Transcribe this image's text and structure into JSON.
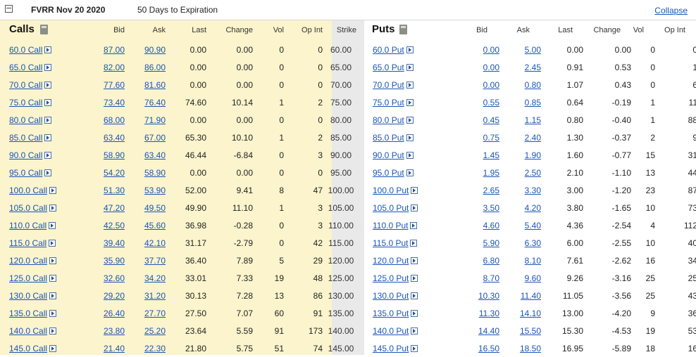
{
  "title": {
    "symbol": "FVRR Nov 20 2020",
    "expiration": "50 Days to Expiration",
    "collapse_label": "Collapse",
    "collapse_box": "−"
  },
  "headers": {
    "calls": "Calls",
    "puts": "Puts",
    "bid": "Bid",
    "ask": "Ask",
    "last": "Last",
    "change": "Change",
    "vol": "Vol",
    "op_int": "Op Int",
    "strike": "Strike"
  },
  "rows": [
    {
      "call": "60.0 Call",
      "c_bid": "87.00",
      "c_ask": "90.90",
      "c_last": "0.00",
      "c_chg": "0.00",
      "c_vol": "0",
      "c_oi": "0",
      "strike": "60.00",
      "put": "60.0 Put",
      "p_bid": "0.00",
      "p_ask": "5.00",
      "p_last": "0.00",
      "p_chg": "0.00",
      "p_vol": "0",
      "p_oi": "0"
    },
    {
      "call": "65.0 Call",
      "c_bid": "82.00",
      "c_ask": "86.00",
      "c_last": "0.00",
      "c_chg": "0.00",
      "c_vol": "0",
      "c_oi": "0",
      "strike": "65.00",
      "put": "65.0 Put",
      "p_bid": "0.00",
      "p_ask": "2.45",
      "p_last": "0.91",
      "p_chg": "0.53",
      "p_vol": "0",
      "p_oi": "1"
    },
    {
      "call": "70.0 Call",
      "c_bid": "77.60",
      "c_ask": "81.60",
      "c_last": "0.00",
      "c_chg": "0.00",
      "c_vol": "0",
      "c_oi": "0",
      "strike": "70.00",
      "put": "70.0 Put",
      "p_bid": "0.00",
      "p_ask": "0.80",
      "p_last": "1.07",
      "p_chg": "0.43",
      "p_vol": "0",
      "p_oi": "6"
    },
    {
      "call": "75.0 Call",
      "c_bid": "73.40",
      "c_ask": "76.40",
      "c_last": "74.60",
      "c_chg": "10.14",
      "c_vol": "1",
      "c_oi": "2",
      "strike": "75.00",
      "put": "75.0 Put",
      "p_bid": "0.55",
      "p_ask": "0.85",
      "p_last": "0.64",
      "p_chg": "-0.19",
      "p_vol": "1",
      "p_oi": "11"
    },
    {
      "call": "80.0 Call",
      "c_bid": "68.00",
      "c_ask": "71.90",
      "c_last": "0.00",
      "c_chg": "0.00",
      "c_vol": "0",
      "c_oi": "0",
      "strike": "80.00",
      "put": "80.0 Put",
      "p_bid": "0.45",
      "p_ask": "1.15",
      "p_last": "0.80",
      "p_chg": "-0.40",
      "p_vol": "1",
      "p_oi": "88"
    },
    {
      "call": "85.0 Call",
      "c_bid": "63.40",
      "c_ask": "67.00",
      "c_last": "65.30",
      "c_chg": "10.10",
      "c_vol": "1",
      "c_oi": "2",
      "strike": "85.00",
      "put": "85.0 Put",
      "p_bid": "0.75",
      "p_ask": "2.40",
      "p_last": "1.30",
      "p_chg": "-0.37",
      "p_vol": "2",
      "p_oi": "9"
    },
    {
      "call": "90.0 Call",
      "c_bid": "58.90",
      "c_ask": "63.40",
      "c_last": "46.44",
      "c_chg": "-6.84",
      "c_vol": "0",
      "c_oi": "3",
      "strike": "90.00",
      "put": "90.0 Put",
      "p_bid": "1.45",
      "p_ask": "1.90",
      "p_last": "1.60",
      "p_chg": "-0.77",
      "p_vol": "15",
      "p_oi": "31"
    },
    {
      "call": "95.0 Call",
      "c_bid": "54.20",
      "c_ask": "58.90",
      "c_last": "0.00",
      "c_chg": "0.00",
      "c_vol": "0",
      "c_oi": "0",
      "strike": "95.00",
      "put": "95.0 Put",
      "p_bid": "1.95",
      "p_ask": "2.50",
      "p_last": "2.10",
      "p_chg": "-1.10",
      "p_vol": "13",
      "p_oi": "44"
    },
    {
      "call": "100.0 Call",
      "c_bid": "51.30",
      "c_ask": "53.90",
      "c_last": "52.00",
      "c_chg": "9.41",
      "c_vol": "8",
      "c_oi": "47",
      "strike": "100.00",
      "put": "100.0 Put",
      "p_bid": "2.65",
      "p_ask": "3.30",
      "p_last": "3.00",
      "p_chg": "-1.20",
      "p_vol": "23",
      "p_oi": "87"
    },
    {
      "call": "105.0 Call",
      "c_bid": "47.20",
      "c_ask": "49.50",
      "c_last": "49.90",
      "c_chg": "11.10",
      "c_vol": "1",
      "c_oi": "3",
      "strike": "105.00",
      "put": "105.0 Put",
      "p_bid": "3.50",
      "p_ask": "4.20",
      "p_last": "3.80",
      "p_chg": "-1.65",
      "p_vol": "10",
      "p_oi": "73"
    },
    {
      "call": "110.0 Call",
      "c_bid": "42.50",
      "c_ask": "45.60",
      "c_last": "36.98",
      "c_chg": "-0.28",
      "c_vol": "0",
      "c_oi": "3",
      "strike": "110.00",
      "put": "110.0 Put",
      "p_bid": "4.60",
      "p_ask": "5.40",
      "p_last": "4.36",
      "p_chg": "-2.54",
      "p_vol": "4",
      "p_oi": "112"
    },
    {
      "call": "115.0 Call",
      "c_bid": "39.40",
      "c_ask": "42.10",
      "c_last": "31.17",
      "c_chg": "-2.79",
      "c_vol": "0",
      "c_oi": "42",
      "strike": "115.00",
      "put": "115.0 Put",
      "p_bid": "5.90",
      "p_ask": "6.30",
      "p_last": "6.00",
      "p_chg": "-2.55",
      "p_vol": "10",
      "p_oi": "40"
    },
    {
      "call": "120.0 Call",
      "c_bid": "35.90",
      "c_ask": "37.70",
      "c_last": "36.40",
      "c_chg": "7.89",
      "c_vol": "5",
      "c_oi": "29",
      "strike": "120.00",
      "put": "120.0 Put",
      "p_bid": "6.80",
      "p_ask": "8.10",
      "p_last": "7.61",
      "p_chg": "-2.62",
      "p_vol": "16",
      "p_oi": "34"
    },
    {
      "call": "125.0 Call",
      "c_bid": "32.60",
      "c_ask": "34.20",
      "c_last": "33.01",
      "c_chg": "7.33",
      "c_vol": "19",
      "c_oi": "48",
      "strike": "125.00",
      "put": "125.0 Put",
      "p_bid": "8.70",
      "p_ask": "9.60",
      "p_last": "9.26",
      "p_chg": "-3.16",
      "p_vol": "25",
      "p_oi": "25"
    },
    {
      "call": "130.0 Call",
      "c_bid": "29.20",
      "c_ask": "31.20",
      "c_last": "30.13",
      "c_chg": "7.28",
      "c_vol": "13",
      "c_oi": "86",
      "strike": "130.00",
      "put": "130.0 Put",
      "p_bid": "10.30",
      "p_ask": "11.40",
      "p_last": "11.05",
      "p_chg": "-3.56",
      "p_vol": "25",
      "p_oi": "43"
    },
    {
      "call": "135.0 Call",
      "c_bid": "26.40",
      "c_ask": "27.70",
      "c_last": "27.50",
      "c_chg": "7.07",
      "c_vol": "60",
      "c_oi": "91",
      "strike": "135.00",
      "put": "135.0 Put",
      "p_bid": "11.30",
      "p_ask": "14.10",
      "p_last": "13.00",
      "p_chg": "-4.20",
      "p_vol": "9",
      "p_oi": "36"
    },
    {
      "call": "140.0 Call",
      "c_bid": "23.80",
      "c_ask": "25.20",
      "c_last": "23.64",
      "c_chg": "5.59",
      "c_vol": "91",
      "c_oi": "173",
      "strike": "140.00",
      "put": "140.0 Put",
      "p_bid": "14.40",
      "p_ask": "15.50",
      "p_last": "15.30",
      "p_chg": "-4.53",
      "p_vol": "19",
      "p_oi": "53"
    },
    {
      "call": "145.0 Call",
      "c_bid": "21.40",
      "c_ask": "22.30",
      "c_last": "21.80",
      "c_chg": "5.75",
      "c_vol": "51",
      "c_oi": "74",
      "strike": "145.00",
      "put": "145.0 Put",
      "p_bid": "16.50",
      "p_ask": "18.50",
      "p_last": "16.95",
      "p_chg": "-5.89",
      "p_vol": "18",
      "p_oi": "16"
    }
  ]
}
